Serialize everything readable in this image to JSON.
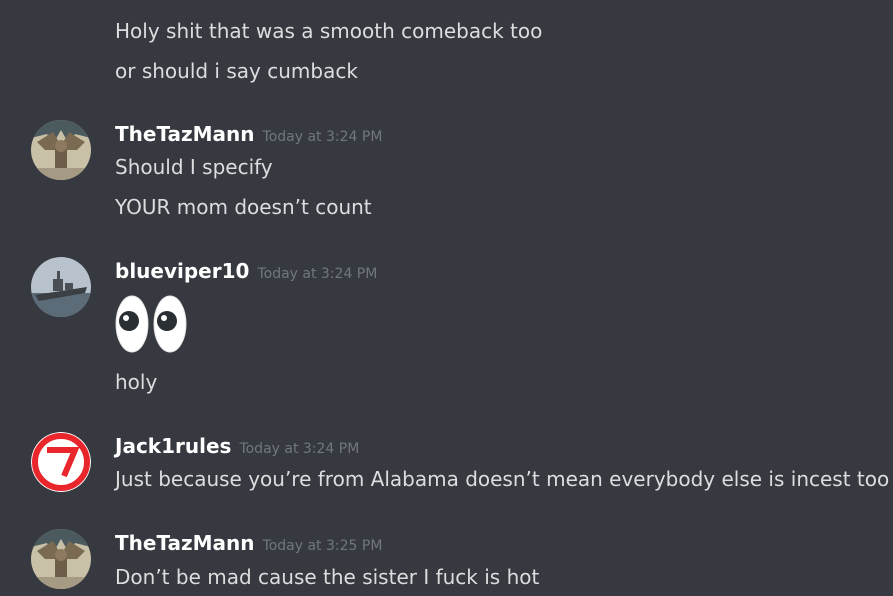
{
  "messages": [
    {
      "lines": [
        "Holy shit that was a smooth comeback too",
        "or should i say cumback"
      ]
    },
    {
      "author": "TheTazMann",
      "timestamp": "Today at 3:24 PM",
      "avatar_icon": "gargoyle-statue-avatar",
      "lines": [
        "Should I specify",
        "YOUR mom doesn’t count"
      ]
    },
    {
      "author": "blueviper10",
      "timestamp": "Today at 3:24 PM",
      "avatar_icon": "battleship-avatar",
      "emoji": "eyes-emoji",
      "lines": [
        "holy"
      ]
    },
    {
      "author": "Jack1rules",
      "timestamp": "Today at 3:24 PM",
      "avatar_icon": "red-circle-logo-avatar",
      "lines": [
        "Just because you’re from Alabama doesn’t mean everybody else is incest too"
      ]
    },
    {
      "author": "TheTazMann",
      "timestamp": "Today at 3:25 PM",
      "avatar_icon": "gargoyle-statue-avatar",
      "lines": [
        "Don’t be mad cause the sister I fuck is hot"
      ]
    }
  ],
  "colors": {
    "background": "#36393f",
    "message_text": "#dcddde",
    "username": "#ffffff",
    "timestamp": "#72767d",
    "jack_logo_red": "#e8262b"
  }
}
